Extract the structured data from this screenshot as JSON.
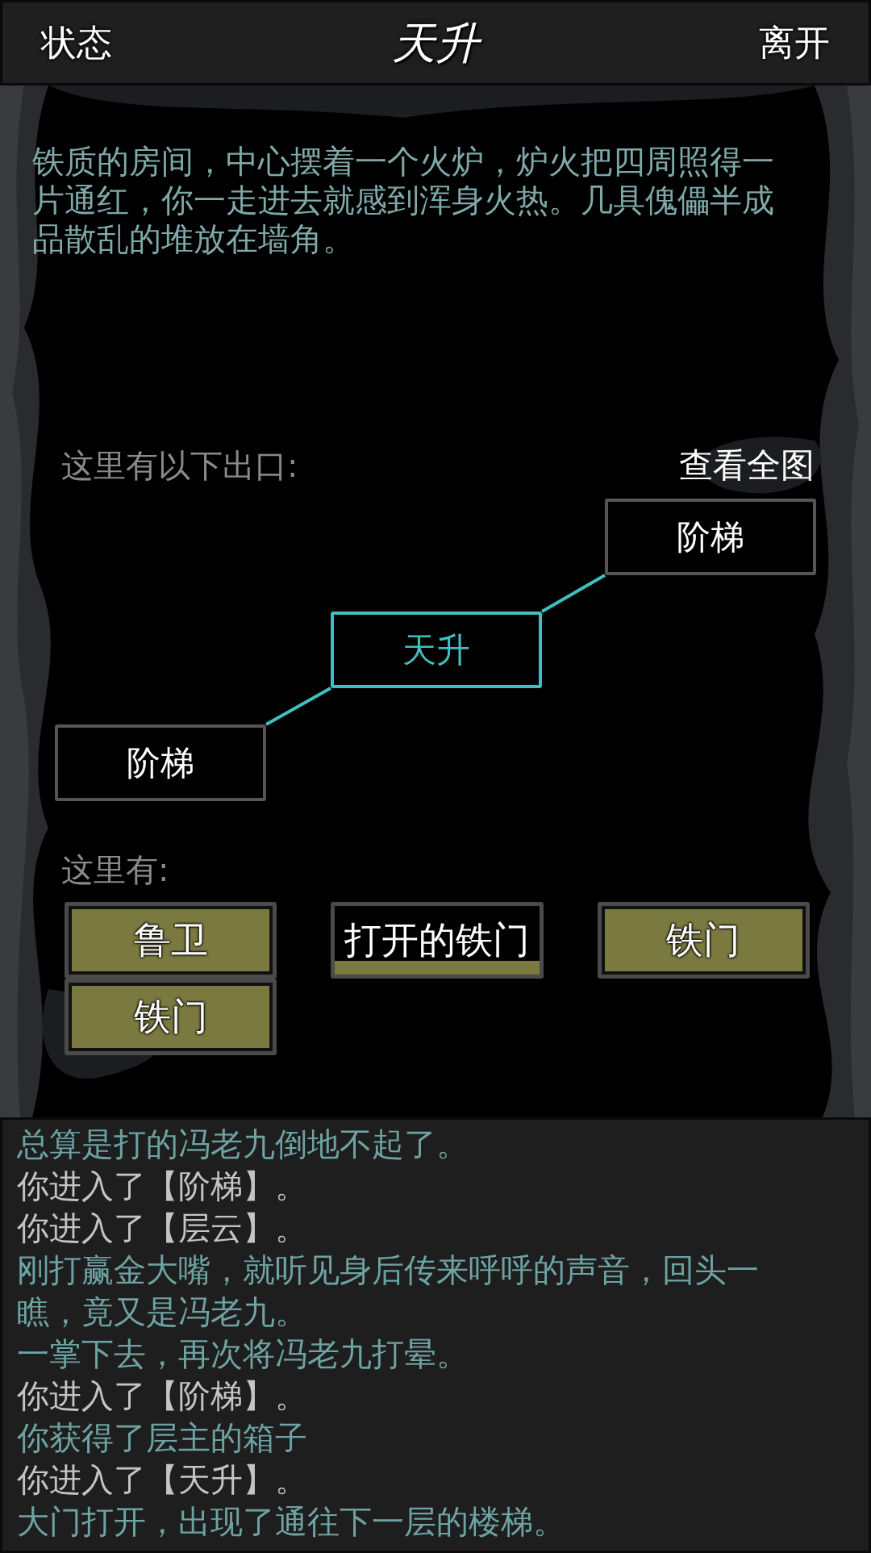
{
  "top_bar": {
    "left_button": "状态",
    "title": "天升",
    "right_button": "离开"
  },
  "description": "铁质的房间，中心摆着一个火炉，炉火把四周照得一片通红，你一走进去就感到浑身火热。几具傀儡半成品散乱的堆放在墙角。",
  "exits_label": "这里有以下出口:",
  "full_map_link": "查看全图",
  "map_nodes": [
    {
      "label": "阶梯",
      "current": false
    },
    {
      "label": "天升",
      "current": true
    },
    {
      "label": "阶梯",
      "current": false
    }
  ],
  "here_label": "这里有:",
  "items": [
    {
      "label": "鲁卫",
      "highlighted": true
    },
    {
      "label": "打开的铁门",
      "highlighted": false
    },
    {
      "label": "铁门",
      "highlighted": true
    },
    {
      "label": "铁门",
      "highlighted": true
    }
  ],
  "log": [
    {
      "text": "总算是打的冯老九倒地不起了。",
      "kind": "story"
    },
    {
      "text": "你进入了【阶梯】。",
      "kind": "system"
    },
    {
      "text": "你进入了【层云】。",
      "kind": "system"
    },
    {
      "text": "刚打赢金大嘴，就听见身后传来呼呼的声音，回头一瞧，竟又是冯老九。",
      "kind": "story"
    },
    {
      "text": "一掌下去，再次将冯老九打晕。",
      "kind": "story"
    },
    {
      "text": "你进入了【阶梯】。",
      "kind": "system"
    },
    {
      "text": "你获得了层主的箱子",
      "kind": "story"
    },
    {
      "text": "你进入了【天升】。",
      "kind": "system"
    },
    {
      "text": "大门打开，出现了通往下一层的楼梯。",
      "kind": "story"
    }
  ]
}
